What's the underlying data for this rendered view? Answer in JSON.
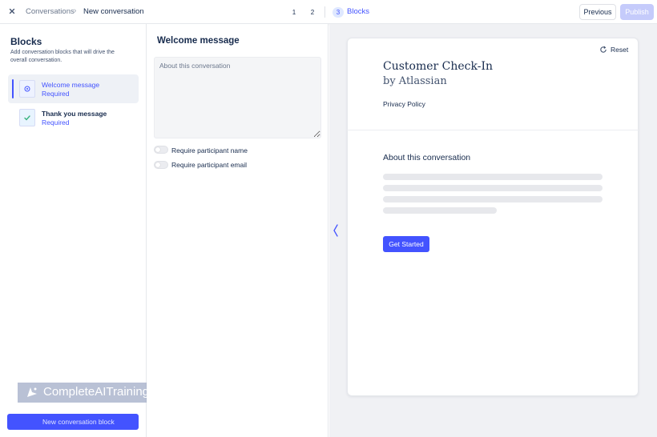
{
  "topbar": {
    "breadcrumb_root": "Conversations",
    "breadcrumb_current": "New conversation",
    "steps": [
      "1",
      "2",
      "3"
    ],
    "active_step_label": "Blocks",
    "previous_label": "Previous",
    "publish_label": "Publish"
  },
  "left": {
    "title": "Blocks",
    "description": "Add conversation blocks that will drive the overall conversation.",
    "blocks": [
      {
        "title": "Welcome message",
        "subtitle": "Required",
        "selected": true
      },
      {
        "title": "Thank you message",
        "subtitle": "Required",
        "selected": false
      }
    ],
    "new_block_label": "New conversation block",
    "watermark": "CompleteAITraining.com"
  },
  "editor": {
    "title": "Welcome message",
    "about_placeholder": "About this conversation",
    "toggles": [
      {
        "label": "Require participant name",
        "on": false
      },
      {
        "label": "Require participant email",
        "on": false
      }
    ]
  },
  "preview": {
    "reset_label": "Reset",
    "title": "Customer Check-In",
    "subtitle": "by Atlassian",
    "privacy_label": "Privacy Policy",
    "about_heading": "About this conversation",
    "cta_label": "Get Started"
  },
  "colors": {
    "accent": "#4353ff",
    "preview_bg": "#f0f1f4"
  }
}
